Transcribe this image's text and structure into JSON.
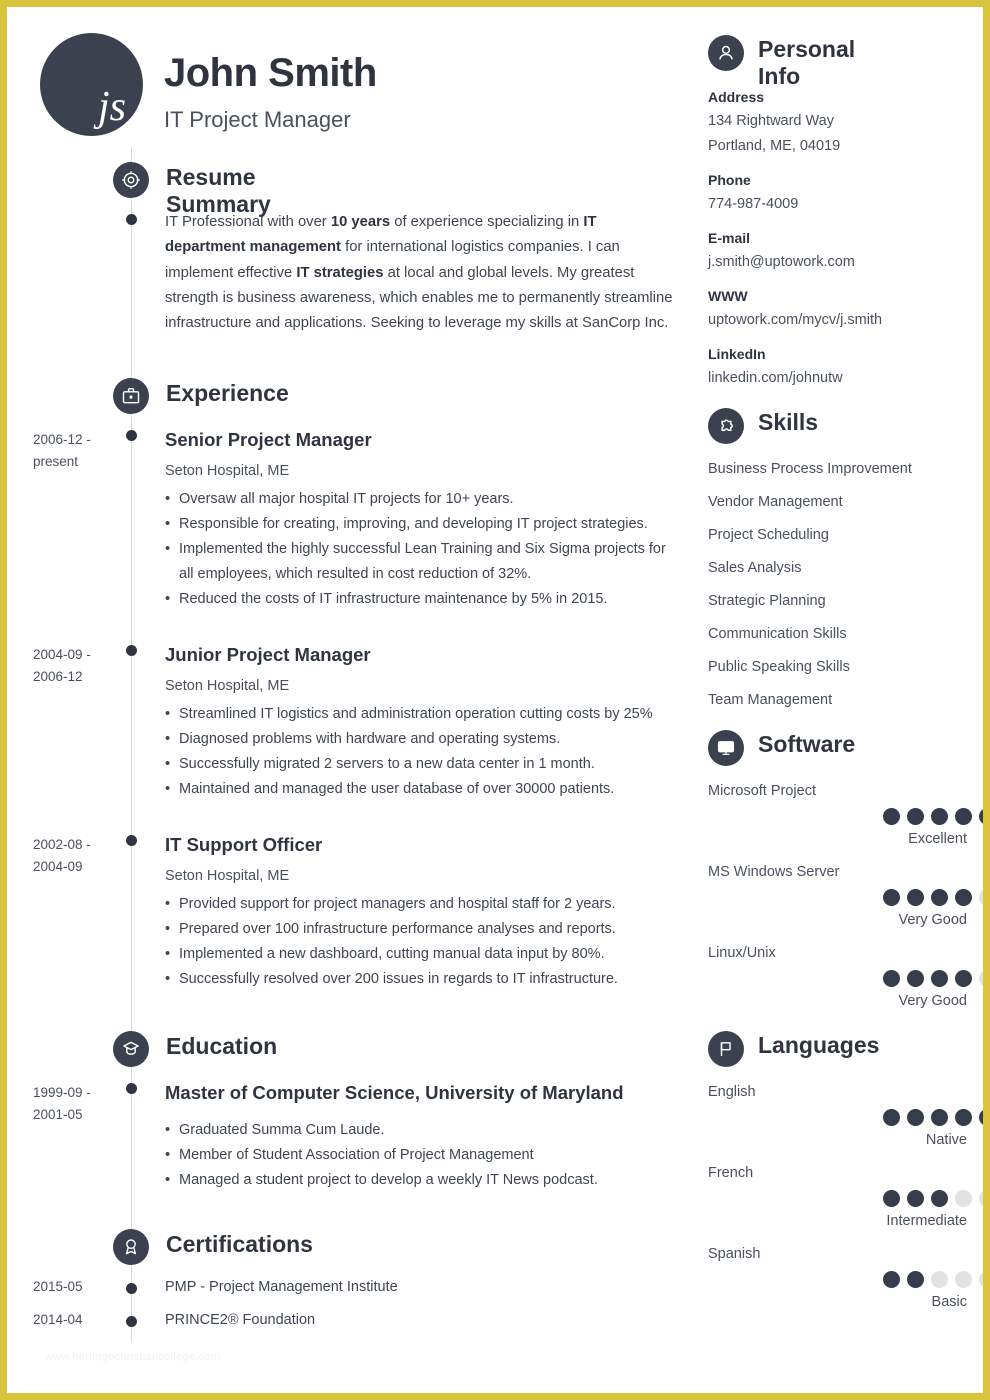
{
  "theme": {
    "accent": "#d9c53b",
    "dark": "#3b414f",
    "dot_on": "#353d4a",
    "dot_off": "#e2e2e2"
  },
  "header": {
    "monogram": "js",
    "name": "John Smith",
    "job_title": "IT Project Manager"
  },
  "watermark": "www.heritagechristiancollege.com",
  "sections": {
    "summary": {
      "title": "Resume Summary",
      "icon": "target-icon",
      "text_html": "IT Professional with over <b>10 years</b> of experience specializing in <b>IT department management</b> for international logistics companies. I can implement effective <b>IT strategies</b> at local and global levels. My greatest strength is business awareness, which enables me to permanently streamline infrastructure and applications. Seeking to leverage my skills at SanCorp Inc."
    },
    "experience": {
      "title": "Experience",
      "icon": "briefcase-icon",
      "entries": [
        {
          "date_line1": "2006-12 -",
          "date_line2": "present",
          "role": "Senior Project Manager",
          "org": "Seton Hospital, ME",
          "bullets": [
            "Oversaw all major hospital IT projects for 10+ years.",
            "Responsible for creating, improving, and developing IT project strategies.",
            "Implemented the highly successful Lean Training and Six Sigma projects for all employees, which resulted in cost reduction of 32%.",
            "Reduced the costs of IT infrastructure maintenance by 5% in 2015."
          ]
        },
        {
          "date_line1": "2004-09 -",
          "date_line2": "2006-12",
          "role": "Junior Project Manager",
          "org": "Seton Hospital, ME",
          "bullets": [
            "Streamlined IT logistics and administration operation cutting costs by 25%",
            "Diagnosed problems with hardware and operating systems.",
            "Successfully migrated 2 servers to a new data center in 1 month.",
            "Maintained and managed the user database of over 30000 patients."
          ]
        },
        {
          "date_line1": "2002-08 -",
          "date_line2": "2004-09",
          "role": "IT Support Officer",
          "org": "Seton Hospital, ME",
          "bullets": [
            "Provided support for project managers and hospital staff for 2 years.",
            "Prepared over 100 infrastructure performance analyses and reports.",
            "Implemented a new dashboard, cutting manual data input by 80%.",
            "Successfully resolved over 200 issues in regards to IT infrastructure."
          ]
        }
      ]
    },
    "education": {
      "title": "Education",
      "icon": "graduation-cap-icon",
      "entries": [
        {
          "date_line1": "1999-09 -",
          "date_line2": "2001-05",
          "role": "Master of Computer Science, University of Maryland",
          "bullets": [
            "Graduated Summa Cum Laude.",
            "Member of Student Association of Project Management",
            "Managed a student project to develop a weekly IT News podcast."
          ]
        }
      ]
    },
    "certifications": {
      "title": "Certifications",
      "icon": "award-ribbon-icon",
      "entries": [
        {
          "date": "2015-05",
          "label": "PMP - Project Management Institute"
        },
        {
          "date": "2014-04",
          "label": "PRINCE2® Foundation"
        }
      ]
    }
  },
  "sidebar": {
    "personal_info": {
      "title": "Personal Info",
      "icon": "person-icon",
      "fields": [
        {
          "label": "Address",
          "value1": "134 Rightward Way",
          "value2": "Portland, ME, 04019"
        },
        {
          "label": "Phone",
          "value1": "774-987-4009"
        },
        {
          "label": "E-mail",
          "value1": "j.smith@uptowork.com"
        },
        {
          "label": "WWW",
          "value1": "uptowork.com/mycv/j.smith"
        },
        {
          "label": "LinkedIn",
          "value1": "linkedin.com/johnutw"
        }
      ]
    },
    "skills": {
      "title": "Skills",
      "icon": "puzzle-piece-icon",
      "items": [
        "Business Process Improvement",
        "Vendor Management",
        "Project Scheduling",
        "Sales Analysis",
        "Strategic Planning",
        "Communication Skills",
        "Public Speaking Skills",
        "Team Management"
      ]
    },
    "software": {
      "title": "Software",
      "icon": "monitor-icon",
      "max_rating": 5,
      "items": [
        {
          "name": "Microsoft Project",
          "rating": 5,
          "level": "Excellent"
        },
        {
          "name": "MS Windows Server",
          "rating": 4,
          "level": "Very Good"
        },
        {
          "name": "Linux/Unix",
          "rating": 4,
          "level": "Very Good"
        }
      ]
    },
    "languages": {
      "title": "Languages",
      "icon": "flag-icon",
      "max_rating": 5,
      "items": [
        {
          "name": "English",
          "rating": 5,
          "level": "Native"
        },
        {
          "name": "French",
          "rating": 3,
          "level": "Intermediate"
        },
        {
          "name": "Spanish",
          "rating": 2,
          "level": "Basic"
        }
      ]
    }
  }
}
